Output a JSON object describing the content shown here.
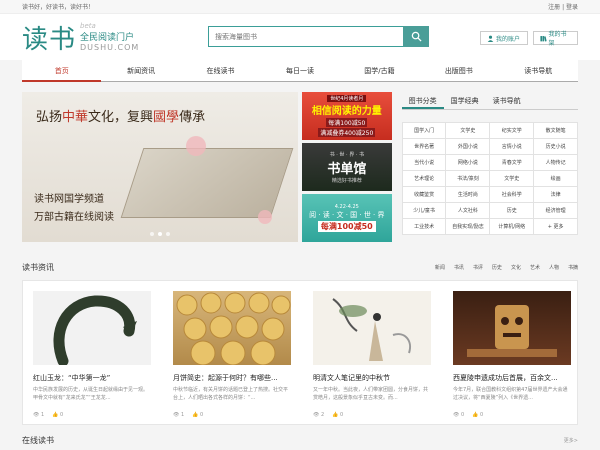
{
  "topbar": {
    "greeting": "读书好，好读书，读好书！",
    "links": "注册 | 登录"
  },
  "logo": {
    "main": "读书",
    "beta": "beta",
    "sub": "全民阅读门户",
    "en": "DUSHU.COM"
  },
  "search": {
    "placeholder": "搜索海量图书"
  },
  "account": {
    "my_account": "我的账户",
    "my_shelf": "我的书架"
  },
  "nav": [
    "首页",
    "新闻资讯",
    "在线读书",
    "每日一读",
    "国学/古籍",
    "出版图书",
    "读书导航"
  ],
  "banner": {
    "title_a": "弘扬",
    "title_red1": "中華",
    "title_b": "文化，复興",
    "title_red2": "國學",
    "title_c": "傳承",
    "sub1": "读书网国学频道",
    "sub2": "万部古籍在线阅读"
  },
  "promo": {
    "p1_badge": "世纪4月读者月",
    "p1_big": "相信阅读的力量",
    "p1_line1": "每满100减50",
    "p1_line2": "满减叠券400减250",
    "p2_top": "书 · 世 · 界 · 书",
    "p2_big": "书单馆",
    "p2_sub": "精选好书推荐",
    "p3_date": "4.22-4.25",
    "p3_title": "阅 · 读 · 文 · 国 · 世 · 界",
    "p3_deal": "每满100减50"
  },
  "cats": {
    "tabs": [
      "图书分类",
      "国学经典",
      "读书导航"
    ],
    "items": [
      "国学入门",
      "文学史",
      "纪实文学",
      "散文随笔",
      "世界名著",
      "外国小说",
      "言情小说",
      "历史小说",
      "当代小说",
      "网络小说",
      "青春文学",
      "人物传记",
      "艺术理论",
      "书法/篆刻",
      "文学史",
      "绘画",
      "收藏鉴赏",
      "生活时尚",
      "社会科学",
      "法律",
      "少儿/童书",
      "人文社科",
      "历史",
      "经济管理",
      "工业技术",
      "自我实现/励志",
      "计算机/网络",
      "+ 更多"
    ]
  },
  "news": {
    "title": "读书资讯",
    "tabs": [
      "新闻",
      "书讯",
      "书评",
      "历史",
      "文化",
      "艺术",
      "人物",
      "书摘"
    ],
    "cards": [
      {
        "title": "红山玉龙：“中华第一龙”",
        "desc": "中华民族发展的历史，从诞生日起就缘由于见一观。甲骨文中就有“龙来氏龙”“王龙龙...",
        "likes": "1",
        "comments": "0"
      },
      {
        "title": "月饼简史：起源于何时？有哪些...",
        "desc": "中秋节临近，有关月饼的话题已登上了热搜。社交平台上，人们晒出各式各样的月饼：“...",
        "likes": "1",
        "comments": "0"
      },
      {
        "title": "明清文人笔记里的中秋节",
        "desc": "又一年中秋。当此夜，人们带家团圆，分食月饼，共赏皓月，这般景象似乎亘古未变。而...",
        "likes": "2",
        "comments": "0"
      },
      {
        "title": "西夏陵申遗成功后首展，百余文...",
        "desc": "今年7月，联合国教科文组织第47届世界遗产大会通过决议，将“西夏陵”列入《世界遗...",
        "likes": "0",
        "comments": "0"
      }
    ]
  },
  "bottom": {
    "title": "在线读书",
    "more": "更多>"
  },
  "colors": {
    "accent": "#2a8a84",
    "active": "#c0392b"
  }
}
